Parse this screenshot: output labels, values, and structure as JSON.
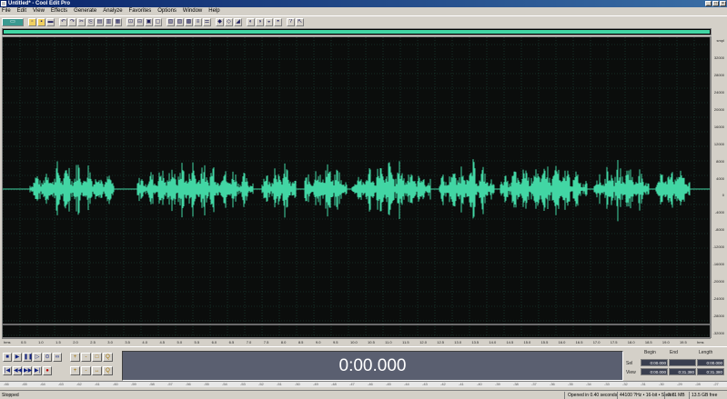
{
  "window": {
    "title": "Untitled* - Cool Edit Pro"
  },
  "menu": [
    "File",
    "Edit",
    "View",
    "Effects",
    "Generate",
    "Analyze",
    "Favorites",
    "Options",
    "Window",
    "Help"
  ],
  "overview": {
    "color": "#42d6a4"
  },
  "waveform": {
    "color": "#42d6a4",
    "background": "#0b0d0c",
    "grid_color": "#1e4a3e"
  },
  "ruler_right": [
    "smpl",
    "32000",
    "28000",
    "24000",
    "20000",
    "16000",
    "12000",
    "8000",
    "4000",
    "0",
    "-4000",
    "-8000",
    "-12000",
    "-16000",
    "-20000",
    "-24000",
    "-28000",
    "-32000"
  ],
  "ruler_bottom": [
    "hms",
    "0.5",
    "1.0",
    "1.5",
    "2.0",
    "2.5",
    "3.0",
    "3.5",
    "4.0",
    "4.5",
    "5.0",
    "5.5",
    "6.0",
    "6.5",
    "7.0",
    "7.5",
    "8.0",
    "8.5",
    "9.0",
    "9.5",
    "10.0",
    "10.5",
    "11.0",
    "11.5",
    "12.0",
    "12.5",
    "13.0",
    "13.5",
    "14.0",
    "14.5",
    "15.0",
    "15.5",
    "16.0",
    "16.5",
    "17.0",
    "17.5",
    "18.0",
    "18.5",
    "19.0",
    "19.5",
    "hms"
  ],
  "transport": {
    "row1": [
      "stop",
      "play",
      "pause",
      "play-looped",
      "play-to-end",
      "loop"
    ],
    "row2": [
      "go-start",
      "rewind",
      "fast-forward",
      "go-end",
      "record",
      ""
    ]
  },
  "zoom_buttons": [
    "+",
    "-",
    "□",
    "Q",
    "+",
    "-",
    "↔",
    "Q"
  ],
  "time_display": "0:00.000",
  "selection": {
    "headers": [
      "Begin",
      "End",
      "Length"
    ],
    "sel_label": "Sel",
    "view_label": "View",
    "sel_values": [
      "0:00.000",
      "",
      "0:00.000"
    ],
    "view_values": [
      "0:00.000",
      "0:31.380",
      "0:31.380"
    ]
  },
  "status": {
    "state": "Stopped",
    "opened": "Opened in 0.40 seconds",
    "format": "44100 ?Hz • 16-bit • Stereo",
    "size": "2.71 MB",
    "free": "13.5 GB free"
  }
}
